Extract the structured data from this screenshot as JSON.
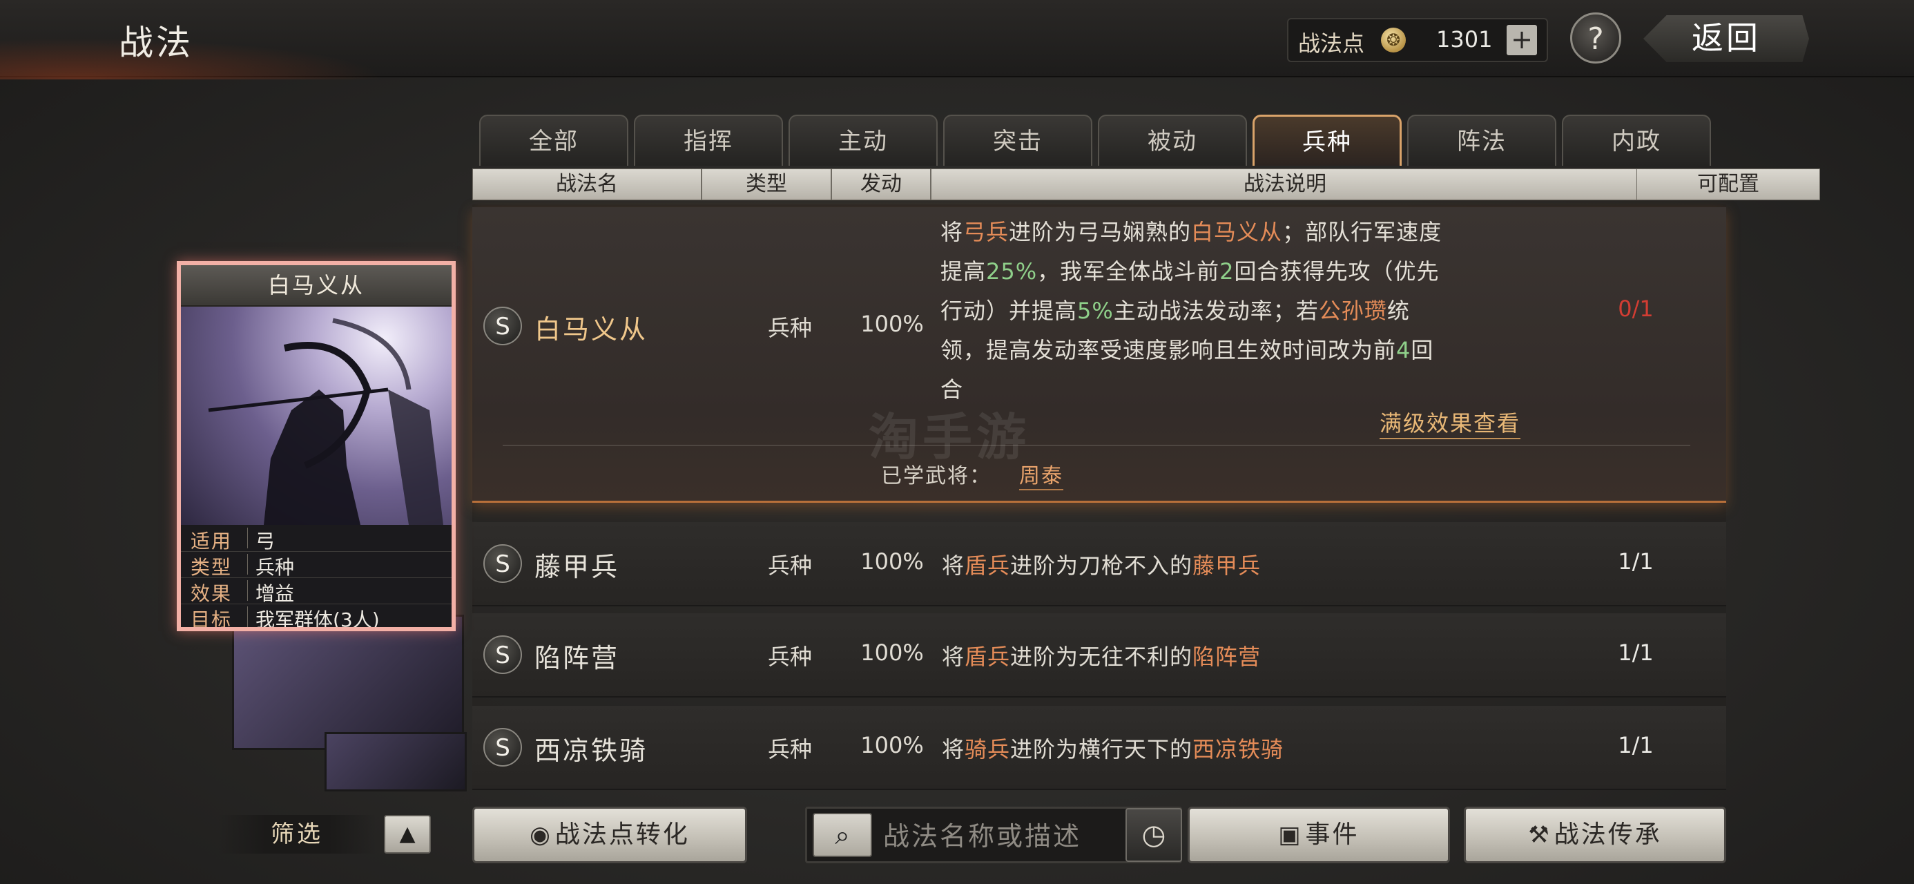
{
  "header": {
    "title": "战法",
    "points_label": "战法点",
    "points_value": "1301",
    "plus_label": "+",
    "help_label": "?",
    "back_label": "返回"
  },
  "tabs": [
    {
      "label": "全部"
    },
    {
      "label": "指挥"
    },
    {
      "label": "主动"
    },
    {
      "label": "突击"
    },
    {
      "label": "被动"
    },
    {
      "label": "兵种",
      "active": true
    },
    {
      "label": "阵法"
    },
    {
      "label": "内政"
    }
  ],
  "columns": {
    "name": "战法名",
    "type": "类型",
    "rate": "发动",
    "desc": "战法说明",
    "config": "可配置"
  },
  "selected_row": {
    "grade": "S",
    "name": "白马义从",
    "type": "兵种",
    "rate": "100%",
    "desc_lines": [
      [
        "将",
        "弓兵",
        "进阶为弓马娴熟的",
        "白马义从",
        "；部队行军速度"
      ],
      [
        "提高",
        "25%",
        "，我军全体战斗前",
        "2",
        "回合获得先攻（优先"
      ],
      [
        "行动）并提高",
        "5%",
        "主动战法发动率；若",
        "公孙瓒",
        "统"
      ],
      [
        "领，提高发动率受速度影响且生效时间改为前",
        "4",
        "回"
      ],
      [
        "合"
      ]
    ],
    "config": "0/1",
    "full_effect_link": "满级效果查看",
    "learned_label": "已学武将：",
    "learned_general": "周泰"
  },
  "rows": [
    {
      "grade": "S",
      "name": "藤甲兵",
      "type": "兵种",
      "rate": "100%",
      "desc": [
        "将",
        "盾兵",
        "进阶为刀枪不入的",
        "藤甲兵"
      ],
      "config": "1/1"
    },
    {
      "grade": "S",
      "name": "陷阵营",
      "type": "兵种",
      "rate": "100%",
      "desc": [
        "将",
        "盾兵",
        "进阶为无往不利的",
        "陷阵营"
      ],
      "config": "1/1"
    },
    {
      "grade": "S",
      "name": "西凉铁骑",
      "type": "兵种",
      "rate": "100%",
      "desc": [
        "将",
        "骑兵",
        "进阶为横行天下的",
        "西凉铁骑"
      ],
      "config": "1/1"
    }
  ],
  "card": {
    "title": "白马义从",
    "info": [
      {
        "key": "适用",
        "value": "弓"
      },
      {
        "key": "类型",
        "value": "兵种"
      },
      {
        "key": "效果",
        "value": "增益"
      },
      {
        "key": "目标",
        "value": "我军群体(3人)"
      }
    ]
  },
  "bottom": {
    "filter_label": "筛选",
    "filter_toggle": "▲",
    "convert_label": "战法点转化",
    "search_placeholder": "战法名称或描述",
    "event_label": "事件",
    "inherit_label": "战法传承"
  },
  "watermark": "淘手游",
  "colors": {
    "accent_orange": "#e58c58",
    "accent_green": "#8fd08a",
    "config_red": "#d23d33",
    "tab_active_border": "#d9a36a"
  }
}
